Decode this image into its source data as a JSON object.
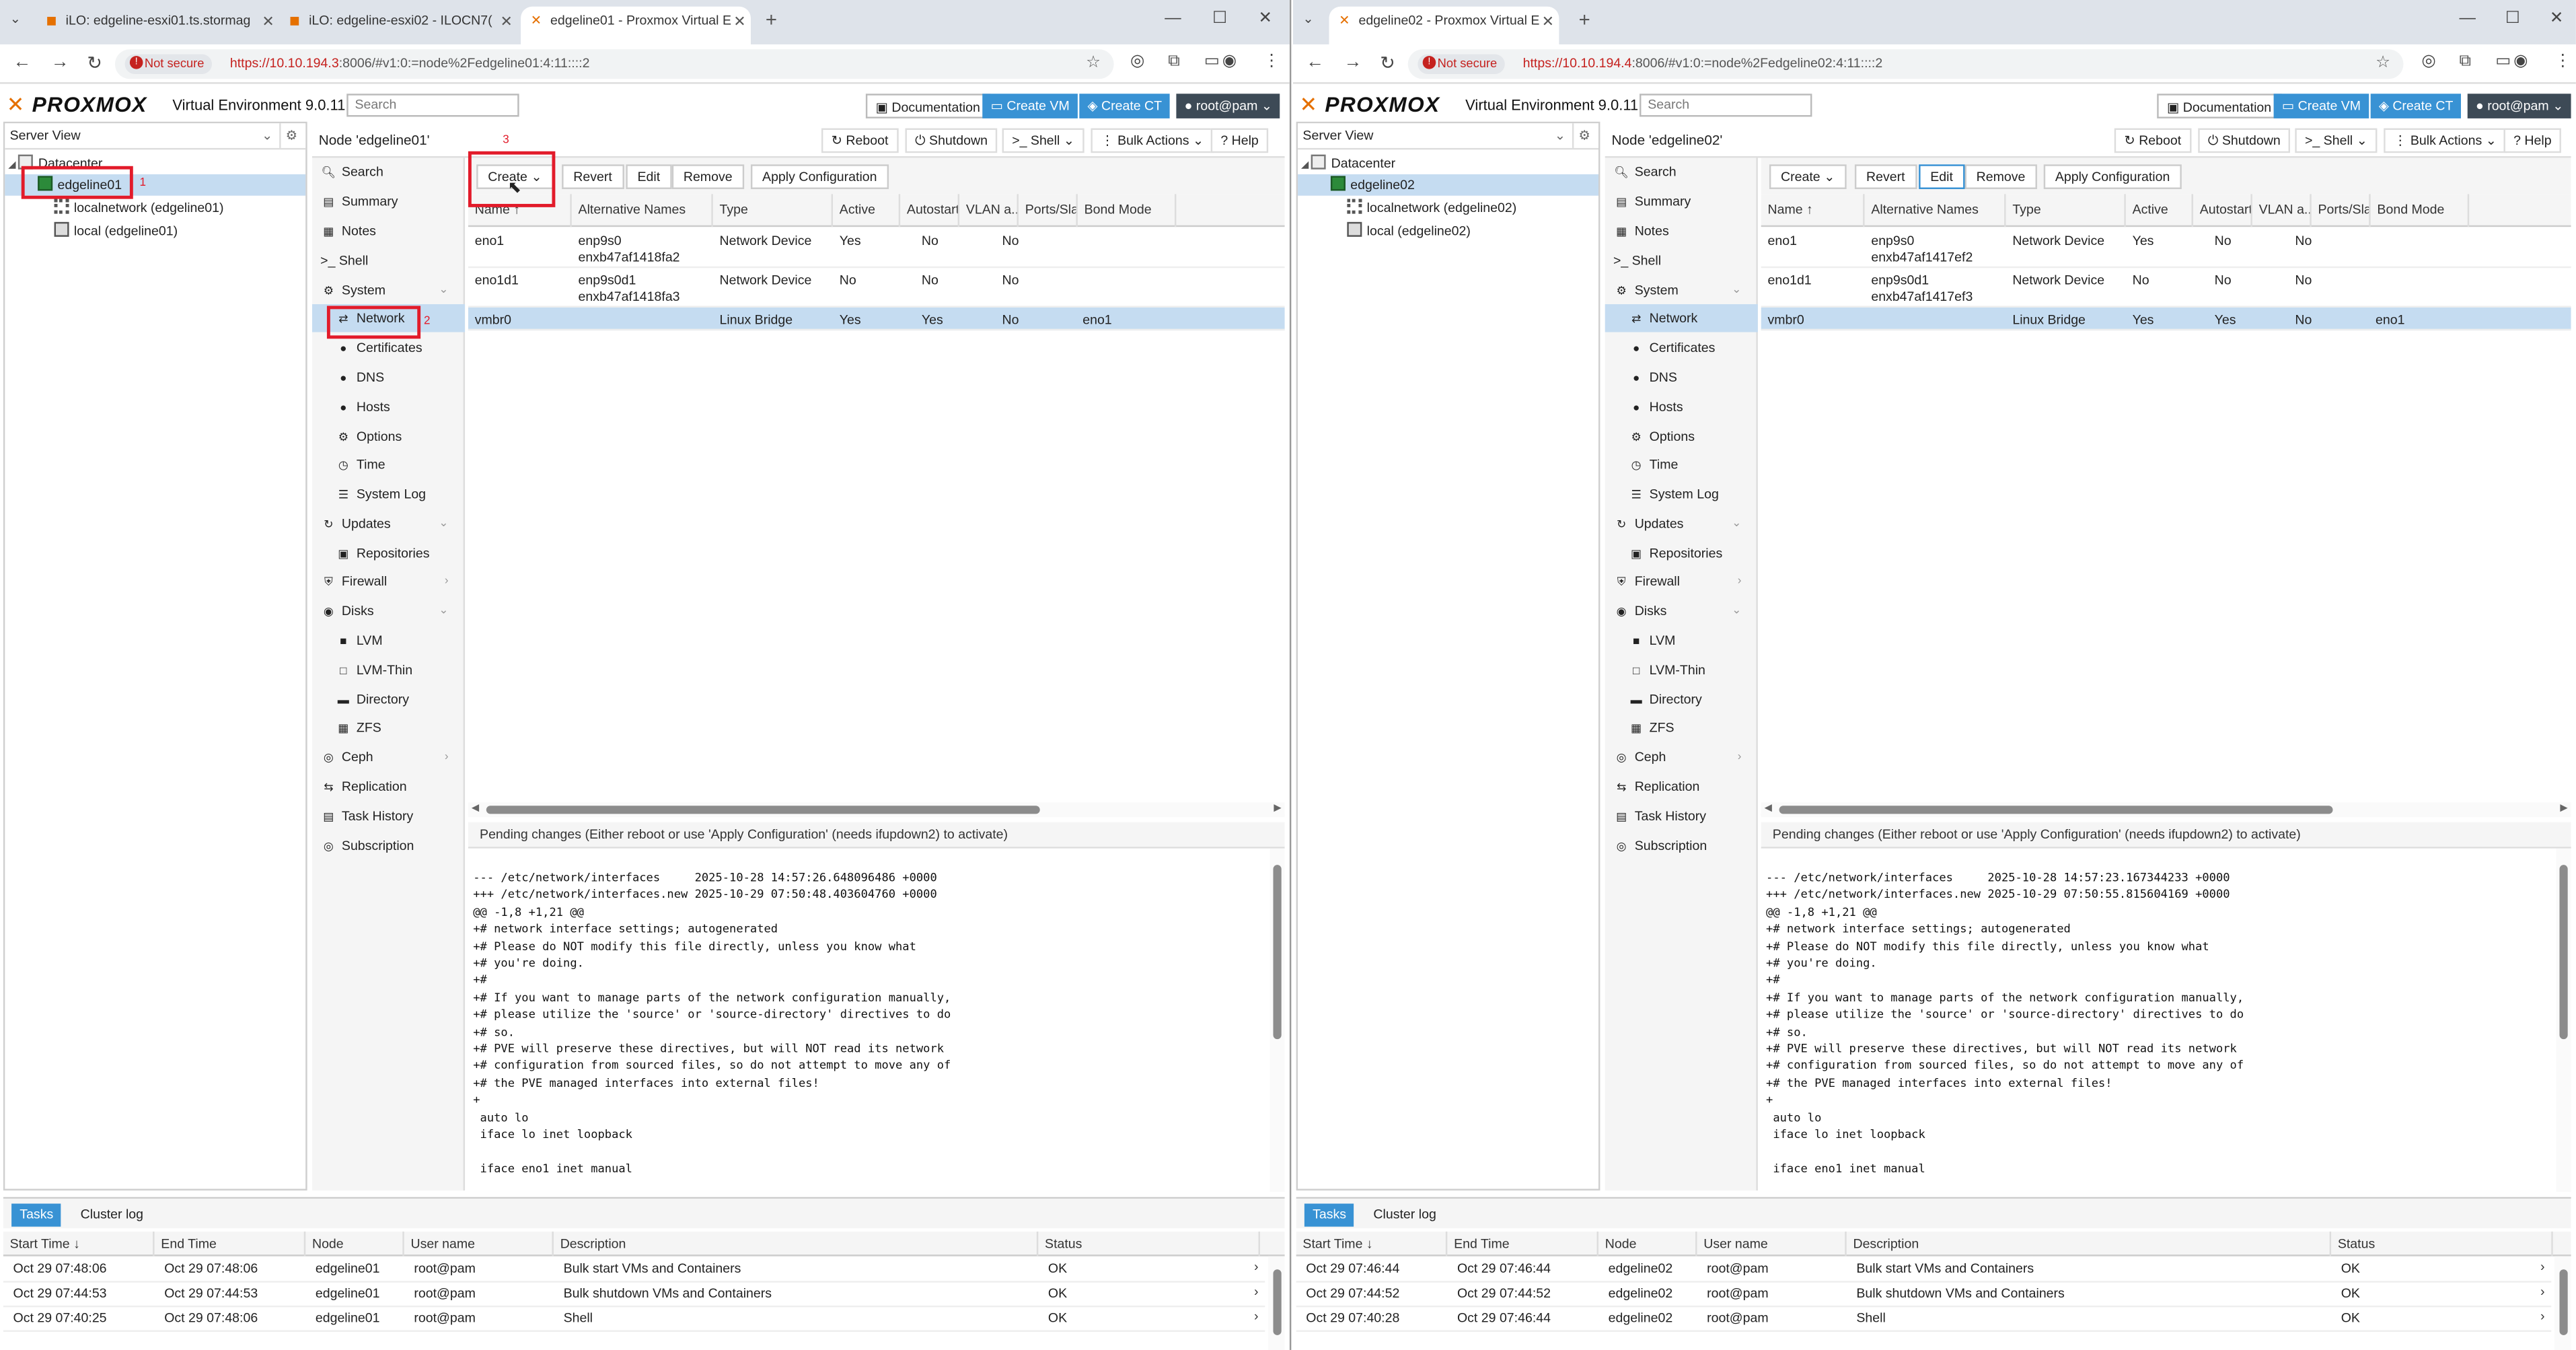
{
  "left": {
    "tabs": [
      {
        "label": "iLO: edgeline-esxi01.ts.stormag"
      },
      {
        "label": "iLO: edgeline-esxi02 - ILOCN7("
      },
      {
        "label": "edgeline01 - Proxmox Virtual E"
      }
    ],
    "address": {
      "not_secure": "Not secure",
      "url_host": "https://10.10.194.3",
      "url_rest": ":8006/#v1:0:=node%2Fedgeline01:4:11::::2"
    },
    "pve": {
      "version": "Virtual Environment 9.0.11",
      "search_placeholder": "Search",
      "documentation": "Documentation",
      "create_vm": "Create VM",
      "create_ct": "Create CT",
      "user": "root@pam",
      "server_view": "Server View",
      "tree": {
        "datacenter": "Datacenter",
        "node": "edgeline01",
        "localnetwork": "localnetwork (edgeline01)",
        "local": "local (edgeline01)"
      },
      "node_title": "Node 'edgeline01'",
      "node_btns": {
        "reboot": "Reboot",
        "shutdown": "Shutdown",
        "shell": "Shell",
        "bulk": "Bulk Actions",
        "help": "Help"
      },
      "toolbar": {
        "create": "Create",
        "revert": "Revert",
        "edit": "Edit",
        "remove": "Remove",
        "apply": "Apply Configuration"
      },
      "columns": [
        "Name ↑",
        "Alternative Names",
        "Type",
        "Active",
        "Autostart",
        "VLAN a...",
        "Ports/Slaves",
        "Bond Mode"
      ],
      "rows": [
        {
          "name": "eno1",
          "alt1": "enp9s0",
          "alt2": "enxb47af1418fa2",
          "type": "Network Device",
          "active": "Yes",
          "autostart": "No",
          "vlan": "No",
          "ports": ""
        },
        {
          "name": "eno1d1",
          "alt1": "enp9s0d1",
          "alt2": "enxb47af1418fa3",
          "type": "Network Device",
          "active": "No",
          "autostart": "No",
          "vlan": "No",
          "ports": ""
        },
        {
          "name": "vmbr0",
          "alt1": "",
          "alt2": "",
          "type": "Linux Bridge",
          "active": "Yes",
          "autostart": "Yes",
          "vlan": "No",
          "ports": "eno1"
        }
      ],
      "pending": "Pending changes (Either reboot or use 'Apply Configuration' (needs ifupdown2) to activate)",
      "diff": "--- /etc/network/interfaces     2025-10-28 14:57:26.648096486 +0000\n+++ /etc/network/interfaces.new 2025-10-29 07:50:48.403604760 +0000\n@@ -1,8 +1,21 @@\n+# network interface settings; autogenerated\n+# Please do NOT modify this file directly, unless you know what\n+# you're doing.\n+#\n+# If you want to manage parts of the network configuration manually,\n+# please utilize the 'source' or 'source-directory' directives to do\n+# so.\n+# PVE will preserve these directives, but will NOT read its network\n+# configuration from sourced files, so do not attempt to move any of\n+# the PVE managed interfaces into external files!\n+\n auto lo\n iface lo inet loopback\n\n iface eno1 inet manual",
      "tasks": [
        {
          "start": "Oct 29 07:48:06",
          "end": "Oct 29 07:48:06",
          "node": "edgeline01",
          "user": "root@pam",
          "desc": "Bulk start VMs and Containers",
          "status": "OK"
        },
        {
          "start": "Oct 29 07:44:53",
          "end": "Oct 29 07:44:53",
          "node": "edgeline01",
          "user": "root@pam",
          "desc": "Bulk shutdown VMs and Containers",
          "status": "OK"
        },
        {
          "start": "Oct 29 07:40:25",
          "end": "Oct 29 07:48:06",
          "node": "edgeline01",
          "user": "root@pam",
          "desc": "Shell",
          "status": "OK"
        }
      ]
    }
  },
  "right": {
    "tabs": [
      {
        "label": "edgeline02 - Proxmox Virtual E"
      }
    ],
    "address": {
      "not_secure": "Not secure",
      "url_host": "https://10.10.194.4",
      "url_rest": ":8006/#v1:0:=node%2Fedgeline02:4:11::::2"
    },
    "pve": {
      "version": "Virtual Environment 9.0.11",
      "search_placeholder": "Search",
      "documentation": "Documentation",
      "create_vm": "Create VM",
      "create_ct": "Create CT",
      "user": "root@pam",
      "server_view": "Server View",
      "tree": {
        "datacenter": "Datacenter",
        "node": "edgeline02",
        "localnetwork": "localnetwork (edgeline02)",
        "local": "local (edgeline02)"
      },
      "node_title": "Node 'edgeline02'",
      "node_btns": {
        "reboot": "Reboot",
        "shutdown": "Shutdown",
        "shell": "Shell",
        "bulk": "Bulk Actions",
        "help": "Help"
      },
      "toolbar": {
        "create": "Create",
        "revert": "Revert",
        "edit": "Edit",
        "remove": "Remove",
        "apply": "Apply Configuration"
      },
      "columns": [
        "Name ↑",
        "Alternative Names",
        "Type",
        "Active",
        "Autostart",
        "VLAN a...",
        "Ports/Slaves",
        "Bond Mode"
      ],
      "rows": [
        {
          "name": "eno1",
          "alt1": "enp9s0",
          "alt2": "enxb47af1417ef2",
          "type": "Network Device",
          "active": "Yes",
          "autostart": "No",
          "vlan": "No",
          "ports": ""
        },
        {
          "name": "eno1d1",
          "alt1": "enp9s0d1",
          "alt2": "enxb47af1417ef3",
          "type": "Network Device",
          "active": "No",
          "autostart": "No",
          "vlan": "No",
          "ports": ""
        },
        {
          "name": "vmbr0",
          "alt1": "",
          "alt2": "",
          "type": "Linux Bridge",
          "active": "Yes",
          "autostart": "Yes",
          "vlan": "No",
          "ports": "eno1"
        }
      ],
      "pending": "Pending changes (Either reboot or use 'Apply Configuration' (needs ifupdown2) to activate)",
      "diff": "--- /etc/network/interfaces     2025-10-28 14:57:23.167344233 +0000\n+++ /etc/network/interfaces.new 2025-10-29 07:50:55.815604169 +0000\n@@ -1,8 +1,21 @@\n+# network interface settings; autogenerated\n+# Please do NOT modify this file directly, unless you know what\n+# you're doing.\n+#\n+# If you want to manage parts of the network configuration manually,\n+# please utilize the 'source' or 'source-directory' directives to do\n+# so.\n+# PVE will preserve these directives, but will NOT read its network\n+# configuration from sourced files, so do not attempt to move any of\n+# the PVE managed interfaces into external files!\n+\n auto lo\n iface lo inet loopback\n\n iface eno1 inet manual",
      "tasks": [
        {
          "start": "Oct 29 07:46:44",
          "end": "Oct 29 07:46:44",
          "node": "edgeline02",
          "user": "root@pam",
          "desc": "Bulk start VMs and Containers",
          "status": "OK"
        },
        {
          "start": "Oct 29 07:44:52",
          "end": "Oct 29 07:44:52",
          "node": "edgeline02",
          "user": "root@pam",
          "desc": "Bulk shutdown VMs and Containers",
          "status": "OK"
        },
        {
          "start": "Oct 29 07:40:28",
          "end": "Oct 29 07:46:44",
          "node": "edgeline02",
          "user": "root@pam",
          "desc": "Shell",
          "status": "OK"
        }
      ]
    }
  },
  "menu": [
    {
      "label": "Search",
      "icon": "search-icon"
    },
    {
      "label": "Summary",
      "icon": "book-icon"
    },
    {
      "label": "Notes",
      "icon": "notes-icon"
    },
    {
      "label": ">_ Shell",
      "icon": ""
    },
    {
      "label": "System",
      "icon": "gear-icon"
    },
    {
      "label": "Network",
      "icon": "network-icon"
    },
    {
      "label": "Certificates",
      "icon": "certificate-icon"
    },
    {
      "label": "DNS",
      "icon": "globe-icon"
    },
    {
      "label": "Hosts",
      "icon": "globe-icon"
    },
    {
      "label": "Options",
      "icon": "gear-icon"
    },
    {
      "label": "Time",
      "icon": "clock-icon"
    },
    {
      "label": "System Log",
      "icon": "list-icon"
    },
    {
      "label": "Updates",
      "icon": "refresh-icon"
    },
    {
      "label": "Repositories",
      "icon": "repo-icon"
    },
    {
      "label": "Firewall",
      "icon": "shield-icon"
    },
    {
      "label": "Disks",
      "icon": "disk-icon"
    },
    {
      "label": "LVM",
      "icon": "square-icon"
    },
    {
      "label": "LVM-Thin",
      "icon": "square-outline-icon"
    },
    {
      "label": "Directory",
      "icon": "folder-icon"
    },
    {
      "label": "ZFS",
      "icon": "grid-icon"
    },
    {
      "label": "Ceph",
      "icon": "ceph-icon"
    },
    {
      "label": "Replication",
      "icon": "retweet-icon"
    },
    {
      "label": "Task History",
      "icon": "history-icon"
    },
    {
      "label": "Subscription",
      "icon": "support-icon"
    }
  ],
  "task_tabs": [
    "Tasks",
    "Cluster log"
  ],
  "task_columns": [
    "Start Time ↓",
    "End Time",
    "Node",
    "User name",
    "Description",
    "Status"
  ],
  "annotations": {
    "n1": "1",
    "n2": "2",
    "n3": "3"
  },
  "colors": {
    "accent": "#3892d4",
    "orange": "#e57000",
    "red_box": "#e21b2a",
    "selection": "#c5dcf1"
  }
}
